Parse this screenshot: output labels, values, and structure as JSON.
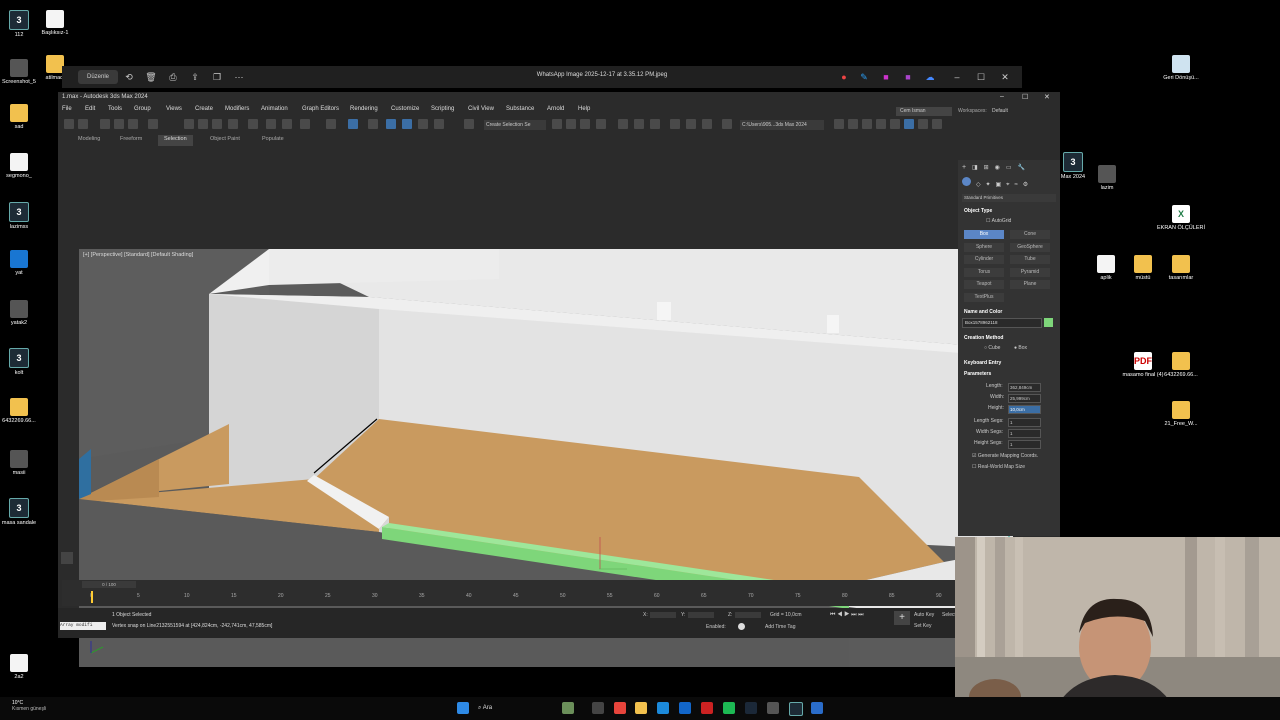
{
  "desktop": {
    "left_icons": [
      {
        "label": "112",
        "kind": "max"
      },
      {
        "label": "Başlıksız-1",
        "kind": "doc"
      },
      {
        "label": "Screenshot_5",
        "kind": "img"
      },
      {
        "label": "atilmadi",
        "kind": "folder"
      },
      {
        "label": "sad",
        "kind": "folder"
      },
      {
        "label": "segmono_",
        "kind": "doc"
      },
      {
        "label": "lazimss",
        "kind": "max"
      },
      {
        "label": "yat",
        "kind": "blue"
      },
      {
        "label": "yatak2",
        "kind": "img"
      },
      {
        "label": "kolt",
        "kind": "max"
      },
      {
        "label": "6432269.66...",
        "kind": "folder"
      },
      {
        "label": "masii",
        "kind": "img"
      },
      {
        "label": "masa sandale",
        "kind": "max"
      },
      {
        "label": "2a2",
        "kind": "doc"
      }
    ],
    "right_icons": [
      {
        "label": "Geri Dönüşü...",
        "kind": "bin"
      },
      {
        "label": "Max 2024",
        "kind": "max"
      },
      {
        "label": "lazim",
        "kind": "img"
      },
      {
        "label": "EKRAN ÖLÇÜLERİ",
        "kind": "xls"
      },
      {
        "label": "aplik",
        "kind": "doc"
      },
      {
        "label": "müstü",
        "kind": "folder"
      },
      {
        "label": "tasarımlar",
        "kind": "folder"
      },
      {
        "label": "masamo final (4)",
        "kind": "pdf"
      },
      {
        "label": "6432269.66...",
        "kind": "folder"
      },
      {
        "label": "21_Free_W...",
        "kind": "folder"
      }
    ]
  },
  "viewer": {
    "edit_label": "Düzenle",
    "title": "WhatsApp Image 2025-12-17 at 3.35.12 PM.jpeg"
  },
  "max": {
    "title": "1.max - Autodesk 3ds Max 2024",
    "menus": [
      "File",
      "Edit",
      "Tools",
      "Group",
      "Views",
      "Create",
      "Modifiers",
      "Animation",
      "Graph Editors",
      "Rendering",
      "Customize",
      "Scripting",
      "Civil View",
      "Substance",
      "Arnold",
      "Help"
    ],
    "user": "Cem Isman",
    "workspaces_label": "Workspaces:",
    "workspace_value": "Default",
    "selection_set": "Create Selection Se",
    "path": "C:\\Users\\905...3ds Max 2024",
    "ribbon_tabs": [
      "Modeling",
      "Freeform",
      "Selection",
      "Object Paint",
      "Populate"
    ],
    "viewport_label": "[+] [Perspective] [Standard] [Default Shading]",
    "command_panel": {
      "category": "Standard Primitives",
      "object_type": "Object Type",
      "autogrid": "AutoGrid",
      "buttons": [
        "Box",
        "Cone",
        "Sphere",
        "GeoSphere",
        "Cylinder",
        "Tube",
        "Torus",
        "Pyramid",
        "Teapot",
        "Plane",
        "TextPlus"
      ],
      "name_and_color": "Name and Color",
      "object_name": "Box1578962118",
      "object_color": "#7ed67a",
      "creation_method": "Creation Method",
      "cm_cube": "Cube",
      "cm_box": "Box",
      "keyboard_entry": "Keyboard Entry",
      "parameters": "Parameters",
      "length_label": "Length:",
      "length_value": "362,849cm",
      "width_label": "Width:",
      "width_value": "25,999cm",
      "height_label": "Height:",
      "height_value": "10,0cm",
      "length_segs_label": "Length Segs:",
      "length_segs": "1",
      "width_segs_label": "Width Segs:",
      "width_segs": "1",
      "height_segs_label": "Height Segs:",
      "height_segs": "1",
      "gen_mapping": "Generate Mapping Coords.",
      "real_world": "Real-World Map Size"
    },
    "timeline": {
      "frame_label": "0 / 100",
      "ticks": [
        "0",
        "5",
        "10",
        "15",
        "20",
        "25",
        "30",
        "35",
        "40",
        "45",
        "50",
        "55",
        "60",
        "65",
        "70",
        "75",
        "80",
        "85",
        "90"
      ]
    },
    "status": {
      "maxscript": "Array modifi",
      "selection": "1 Object Selected",
      "prompt": "Vertex snap on Line2132551594 at [424,824cm, -242,741cm, 47,585cm]",
      "x_label": "X:",
      "y_label": "Y:",
      "z_label": "Z:",
      "grid": "Grid = 10,0cm",
      "enabled": "Enabled:",
      "add_time_tag": "Add Time Tag",
      "auto_key": "Auto Key",
      "set_key": "Set Key",
      "selected": "Selected"
    }
  },
  "taskbar": {
    "weather_temp": "10°C",
    "weather_text": "Kısmen güneşli",
    "search": "Ara"
  }
}
